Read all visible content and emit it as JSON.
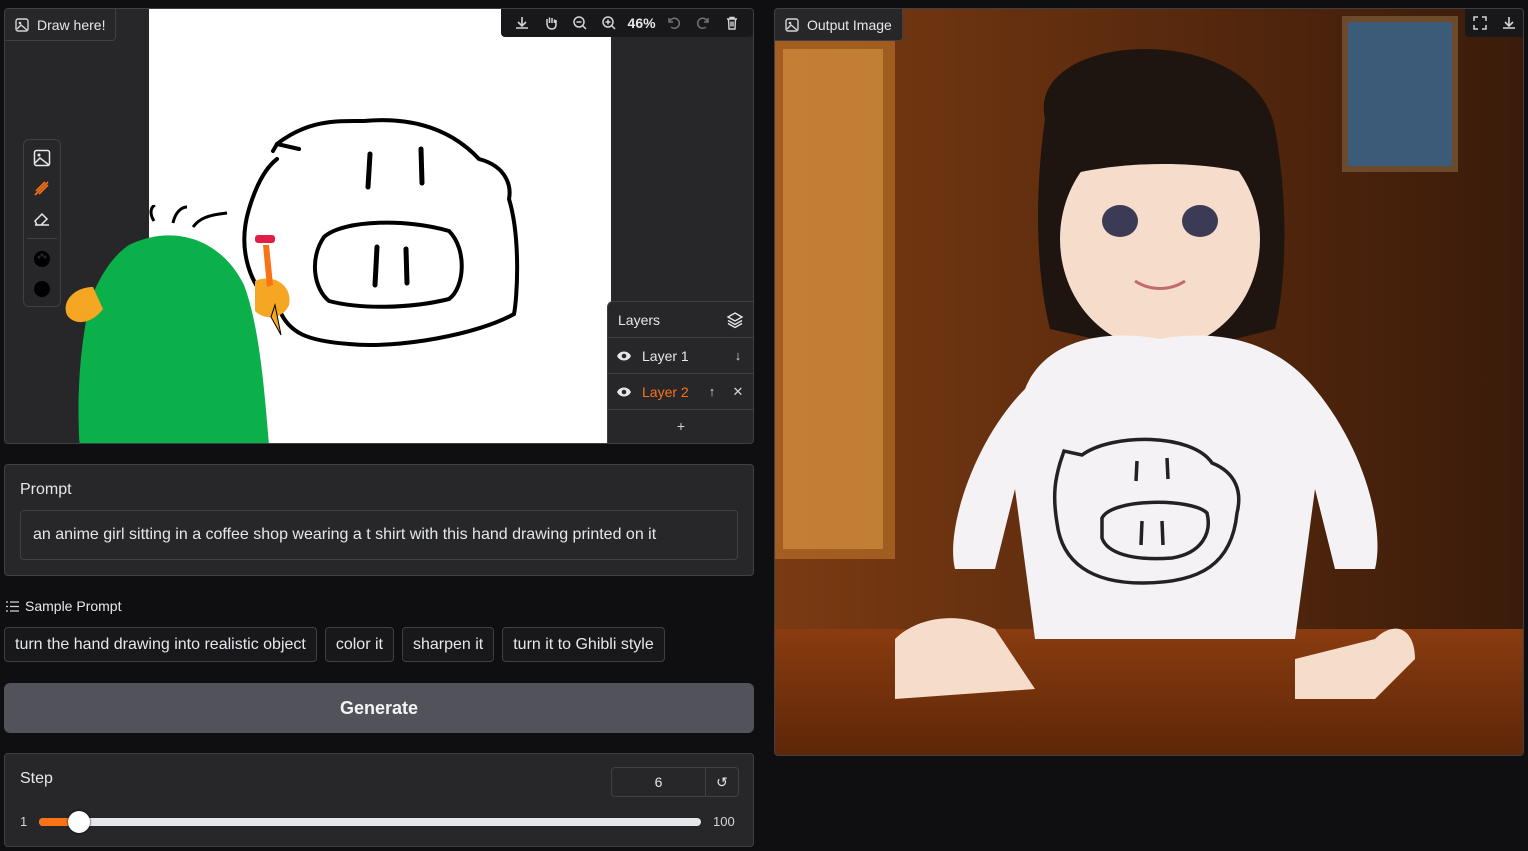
{
  "sketch": {
    "label": "Draw here!",
    "zoom": "46%",
    "layers_title": "Layers",
    "layers": [
      {
        "name": "Layer 1",
        "active": false
      },
      {
        "name": "Layer 2",
        "active": true
      }
    ],
    "add_layer": "+"
  },
  "prompt": {
    "label": "Prompt",
    "value": "an anime girl sitting in a coffee shop wearing a t shirt with this hand drawing printed on it"
  },
  "samples": {
    "header": "Sample Prompt",
    "items": [
      "turn the hand drawing into realistic object",
      "color it",
      "sharpen it",
      "turn it to Ghibli style"
    ]
  },
  "generate_label": "Generate",
  "step": {
    "label": "Step",
    "value": "6",
    "min": "1",
    "max": "100",
    "reset": "↺",
    "fraction": 0.0505
  },
  "output": {
    "label": "Output Image"
  },
  "colors": {
    "accent": "#f97316",
    "panel": "#27272a",
    "background": "#0f0f11",
    "green_blob": "#0bb04a"
  }
}
